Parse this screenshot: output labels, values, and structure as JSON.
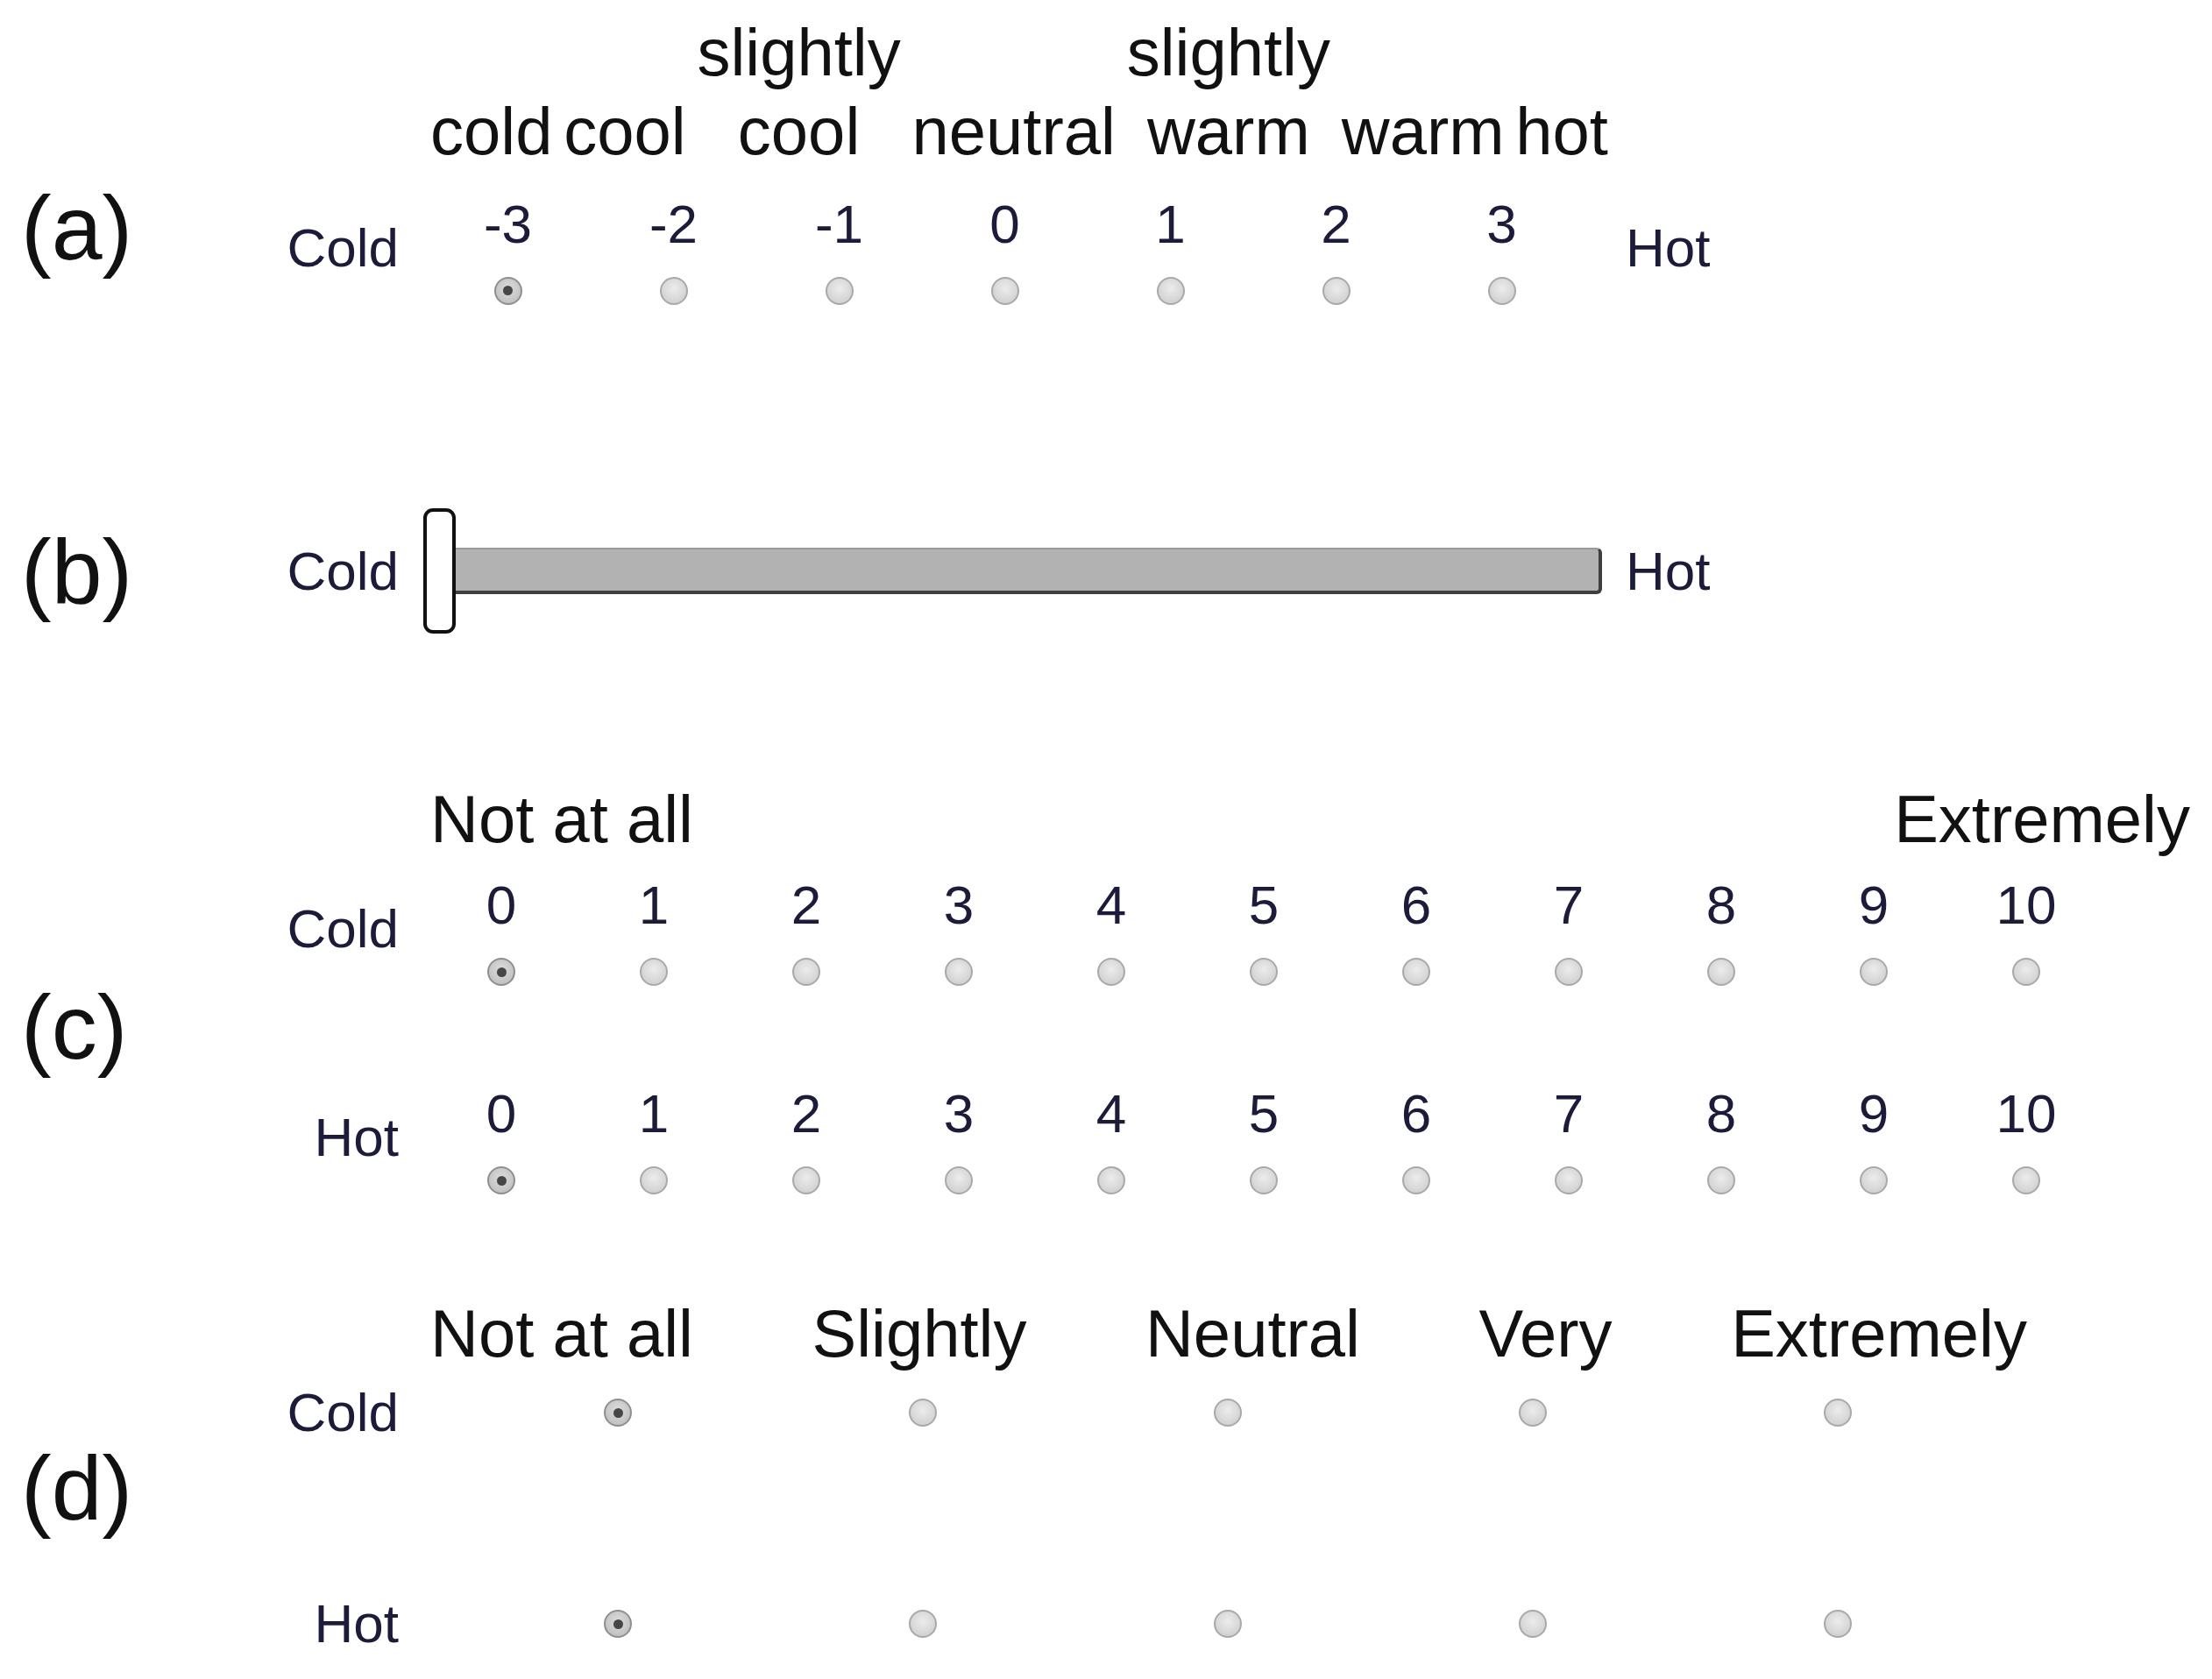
{
  "sections": [
    {
      "kind": "bipolar",
      "marker": "(a)",
      "headers": [
        "cold",
        "cool",
        "slightly cool",
        "neutral",
        "slightly warm",
        "warm",
        "hot"
      ],
      "rows": [
        {
          "left_label": "Cold",
          "right_label": "Hot",
          "options": [
            {
              "value": "-3",
              "selected": true
            },
            {
              "value": "-2",
              "selected": false
            },
            {
              "value": "-1",
              "selected": false
            },
            {
              "value": "0",
              "selected": false
            },
            {
              "value": "1",
              "selected": false
            },
            {
              "value": "2",
              "selected": false
            },
            {
              "value": "3",
              "selected": false
            }
          ]
        }
      ]
    },
    {
      "kind": "slider",
      "marker": "(b)",
      "left_label": "Cold",
      "right_label": "Hot",
      "level": 0
    },
    {
      "kind": "numeric",
      "marker": "(c)",
      "headers": [
        "Not at all",
        "Extremely"
      ],
      "rows": [
        {
          "left_label": "Cold",
          "options": [
            {
              "value": "0",
              "selected": true
            },
            {
              "value": "1",
              "selected": false
            },
            {
              "value": "2",
              "selected": false
            },
            {
              "value": "3",
              "selected": false
            },
            {
              "value": "4",
              "selected": false
            },
            {
              "value": "5",
              "selected": false
            },
            {
              "value": "6",
              "selected": false
            },
            {
              "value": "7",
              "selected": false
            },
            {
              "value": "8",
              "selected": false
            },
            {
              "value": "9",
              "selected": false
            },
            {
              "value": "10",
              "selected": false
            }
          ]
        },
        {
          "left_label": "Hot",
          "options": [
            {
              "value": "0",
              "selected": true
            },
            {
              "value": "1",
              "selected": false
            },
            {
              "value": "2",
              "selected": false
            },
            {
              "value": "3",
              "selected": false
            },
            {
              "value": "4",
              "selected": false
            },
            {
              "value": "5",
              "selected": false
            },
            {
              "value": "6",
              "selected": false
            },
            {
              "value": "7",
              "selected": false
            },
            {
              "value": "8",
              "selected": false
            },
            {
              "value": "9",
              "selected": false
            },
            {
              "value": "10",
              "selected": false
            }
          ]
        }
      ]
    },
    {
      "kind": "verbal",
      "marker": "(d)",
      "headers": [
        "Not at all",
        "Slightly",
        "Neutral",
        "Very",
        "Extremely"
      ],
      "rows": [
        {
          "left_label": "Cold",
          "options": [
            {
              "selected": true
            },
            {
              "selected": false
            },
            {
              "selected": false
            },
            {
              "selected": false
            },
            {
              "selected": false
            }
          ]
        },
        {
          "left_label": "Hot",
          "options": [
            {
              "selected": true
            },
            {
              "selected": false
            },
            {
              "selected": false
            },
            {
              "selected": false
            },
            {
              "selected": false
            }
          ]
        }
      ]
    }
  ]
}
